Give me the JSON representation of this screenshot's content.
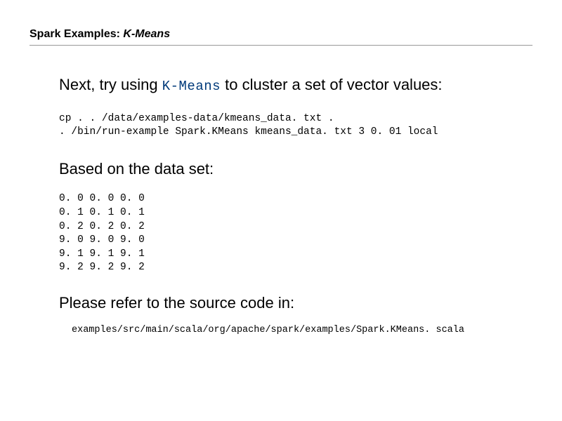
{
  "title": {
    "prefix": "Spark Examples: ",
    "topic": "K-Means"
  },
  "lead": {
    "before": "Next, try using ",
    "keyword": "K-Means",
    "after": " to cluster a set of vector values:"
  },
  "commands": "cp . . /data/examples-data/kmeans_data. txt .\n. /bin/run-example Spark.KMeans kmeans_data. txt 3 0. 01 local",
  "section_heading": "Based on the data set:",
  "dataset": "0. 0 0. 0 0. 0\n0. 1 0. 1 0. 1\n0. 2 0. 2 0. 2\n9. 0 9. 0 9. 0\n9. 1 9. 1 9. 1\n9. 2 9. 2 9. 2",
  "footer_note": "Please refer to the source code in:",
  "source_path": "examples/src/main/scala/org/apache/spark/examples/Spark.KMeans. scala"
}
